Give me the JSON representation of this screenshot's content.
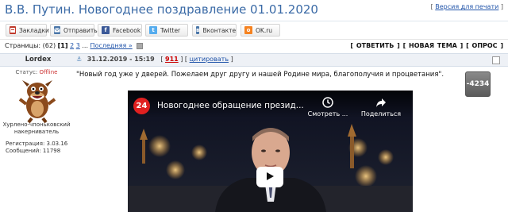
{
  "page": {
    "title": "В.В. Путин. Новогоднее поздравление 01.01.2020",
    "print_link_prefix": "[ ",
    "print_link_text": "Версия для печати",
    "print_link_suffix": " ]"
  },
  "share_bar": {
    "buttons": [
      {
        "label": "Закладки",
        "icon": "bookmark-icon",
        "color": "#c0392b"
      },
      {
        "label": "Отправить",
        "icon": "mail-icon",
        "color": "#4a76a8"
      },
      {
        "label": "Facebook",
        "icon": "facebook-icon",
        "color": "#3b5998"
      },
      {
        "label": "Twitter",
        "icon": "twitter-icon",
        "color": "#55acee"
      },
      {
        "label": "Вконтакте",
        "icon": "vk-icon",
        "color": "#4a76a8"
      },
      {
        "label": "OK.ru",
        "icon": "ok-icon",
        "color": "#f58220"
      }
    ]
  },
  "pagination": {
    "label": "Страницы:",
    "count": "(62)",
    "current": "[1]",
    "page2": "2",
    "page3": "3",
    "ellipsis": "...",
    "last": "Последняя »"
  },
  "actions": {
    "reply": "[ ОТВЕТИТЬ ]",
    "new_topic": "[ НОВАЯ ТЕМА ]",
    "poll": "[ ОПРОС ]"
  },
  "post": {
    "author": "Lordex",
    "anchor_icon": "anchor-icon",
    "date": "31.12.2019 - 15:19",
    "num_prefix": "[ ",
    "number": "911",
    "num_sep": " ] [ ",
    "quote": "цитировать",
    "num_suffix": " ]",
    "status_label": "Статус:",
    "status_value": "Offline",
    "user_title": "Хурлено-чпоньковский накерниватель",
    "registration": "Регистрация: 3.03.16",
    "messages": "Сообщений: 11798",
    "text": "\"Новый год уже у дверей. Пожелаем друг другу и нашей Родине мира, благополучия и процветания\".",
    "rating": "-4234"
  },
  "video": {
    "channel_logo": "24",
    "title": "Новогоднее обращение презид...",
    "watch_later": "Смотреть ...",
    "share": "Поделиться"
  }
}
